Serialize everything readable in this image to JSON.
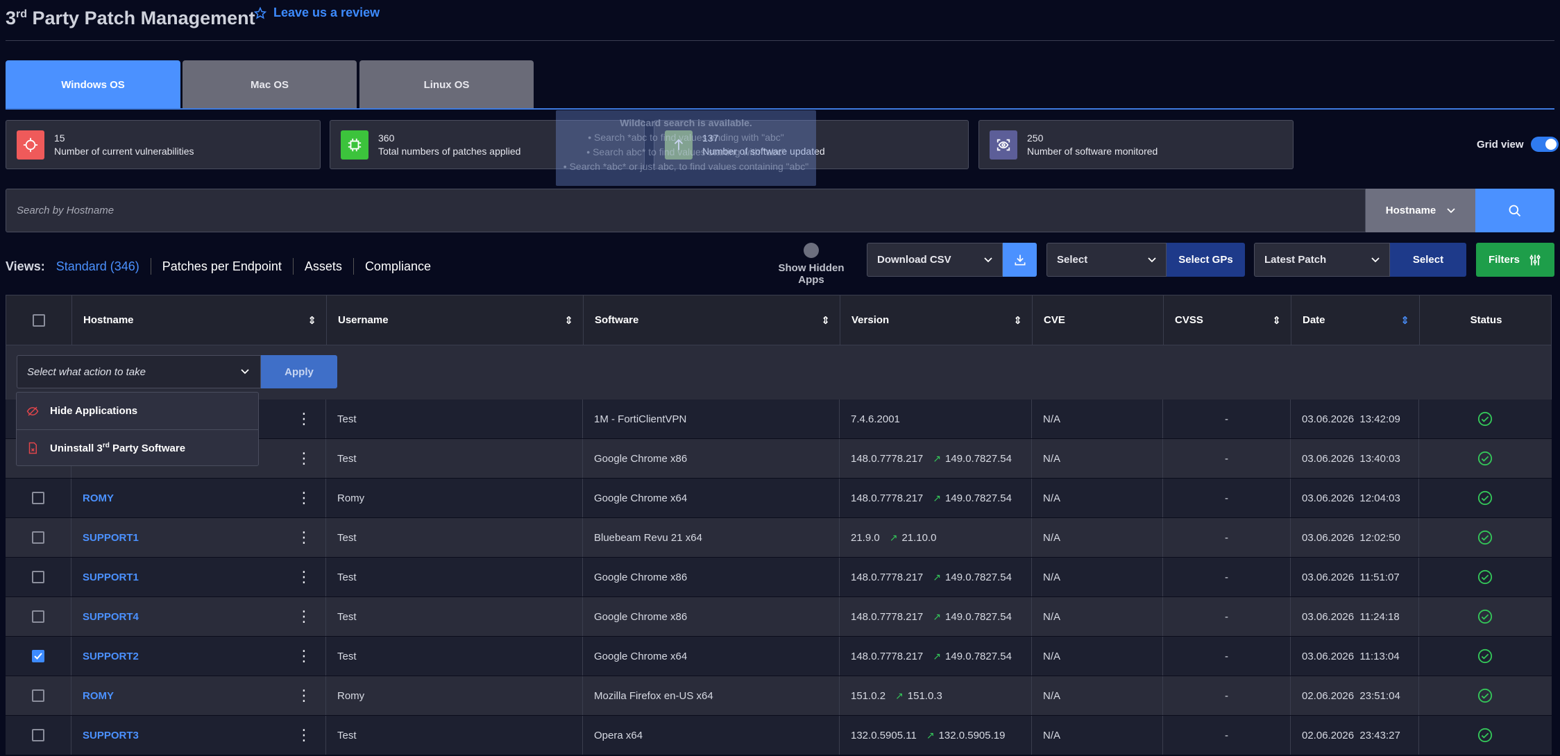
{
  "header": {
    "title_prefix": "3",
    "title_sup": "rd",
    "title_rest": " Party Patch Management",
    "review_label": "Leave us a review"
  },
  "tabs": [
    {
      "label": "Windows OS",
      "active": true
    },
    {
      "label": "Mac OS",
      "active": false
    },
    {
      "label": "Linux OS",
      "active": false
    }
  ],
  "stats": [
    {
      "value": "15",
      "label": "Number of current vulnerabilities",
      "icon": "crosshair-icon",
      "color": "#ef5a5a"
    },
    {
      "value": "360",
      "label": "Total numbers of patches applied",
      "icon": "chip-icon",
      "color": "#3cc33c"
    },
    {
      "value": "137",
      "label": "Number of software updated",
      "icon": "arrow-up-icon",
      "color": "#8fb06a"
    },
    {
      "value": "250",
      "label": "Number of software monitored",
      "icon": "eye-scan-icon",
      "color": "#5c5e98"
    }
  ],
  "tooltip": {
    "line1": "Wildcard search is available.",
    "line2": "• Search *abc to find values ending with \"abc\"",
    "line3": "• Search abc* to find values starting with \"abc\"",
    "line4": "• Search *abc* or just abc, to find values containing \"abc\""
  },
  "grid_view": {
    "label": "Grid view",
    "on": true
  },
  "search": {
    "placeholder": "Search by Hostname",
    "field": "Hostname"
  },
  "views": {
    "label": "Views:",
    "items": [
      "Standard (346)",
      "Patches per Endpoint",
      "Assets",
      "Compliance"
    ]
  },
  "toolbar": {
    "show_hidden": "Show Hidden Apps",
    "download_csv": "Download CSV",
    "select": "Select",
    "select_gps": "Select GPs",
    "latest_patch": "Latest Patch",
    "select2": "Select",
    "filters": "Filters"
  },
  "table": {
    "columns": [
      "Hostname",
      "Username",
      "Software",
      "Version",
      "CVE",
      "CVSS",
      "Date",
      "Status"
    ],
    "action_placeholder": "Select what action to take",
    "apply_label": "Apply",
    "rows": [
      {
        "checked": false,
        "host": "",
        "user": "Test",
        "software": "1M - FortiClientVPN",
        "version": "7.4.6.2001",
        "new_version": "",
        "cve": "N/A",
        "cvss": "-",
        "date": "03.06.2026  13:42:09"
      },
      {
        "checked": false,
        "host": "",
        "user": "Test",
        "software": "Google Chrome x86",
        "version": "148.0.7778.217",
        "new_version": "149.0.7827.54",
        "cve": "N/A",
        "cvss": "-",
        "date": "03.06.2026  13:40:03"
      },
      {
        "checked": false,
        "host": "ROMY",
        "user": "Romy",
        "software": "Google Chrome x64",
        "version": "148.0.7778.217",
        "new_version": "149.0.7827.54",
        "cve": "N/A",
        "cvss": "-",
        "date": "03.06.2026  12:04:03"
      },
      {
        "checked": false,
        "host": "SUPPORT1",
        "user": "Test",
        "software": "Bluebeam Revu 21 x64",
        "version": "21.9.0",
        "new_version": "21.10.0",
        "cve": "N/A",
        "cvss": "-",
        "date": "03.06.2026  12:02:50"
      },
      {
        "checked": false,
        "host": "SUPPORT1",
        "user": "Test",
        "software": "Google Chrome x86",
        "version": "148.0.7778.217",
        "new_version": "149.0.7827.54",
        "cve": "N/A",
        "cvss": "-",
        "date": "03.06.2026  11:51:07"
      },
      {
        "checked": false,
        "host": "SUPPORT4",
        "user": "Test",
        "software": "Google Chrome x86",
        "version": "148.0.7778.217",
        "new_version": "149.0.7827.54",
        "cve": "N/A",
        "cvss": "-",
        "date": "03.06.2026  11:24:18"
      },
      {
        "checked": true,
        "host": "SUPPORT2",
        "user": "Test",
        "software": "Google Chrome x64",
        "version": "148.0.7778.217",
        "new_version": "149.0.7827.54",
        "cve": "N/A",
        "cvss": "-",
        "date": "03.06.2026  11:13:04"
      },
      {
        "checked": false,
        "host": "ROMY",
        "user": "Romy",
        "software": "Mozilla Firefox en-US x64",
        "version": "151.0.2",
        "new_version": "151.0.3",
        "cve": "N/A",
        "cvss": "-",
        "date": "02.06.2026  23:51:04"
      },
      {
        "checked": false,
        "host": "SUPPORT3",
        "user": "Test",
        "software": "Opera x64",
        "version": "132.0.5905.11",
        "new_version": "132.0.5905.19",
        "cve": "N/A",
        "cvss": "-",
        "date": "02.06.2026  23:43:27"
      }
    ]
  },
  "action_menu": {
    "hide": "Hide Applications",
    "uninstall_prefix": "Uninstall 3",
    "uninstall_sup": "rd",
    "uninstall_rest": " Party Software"
  }
}
